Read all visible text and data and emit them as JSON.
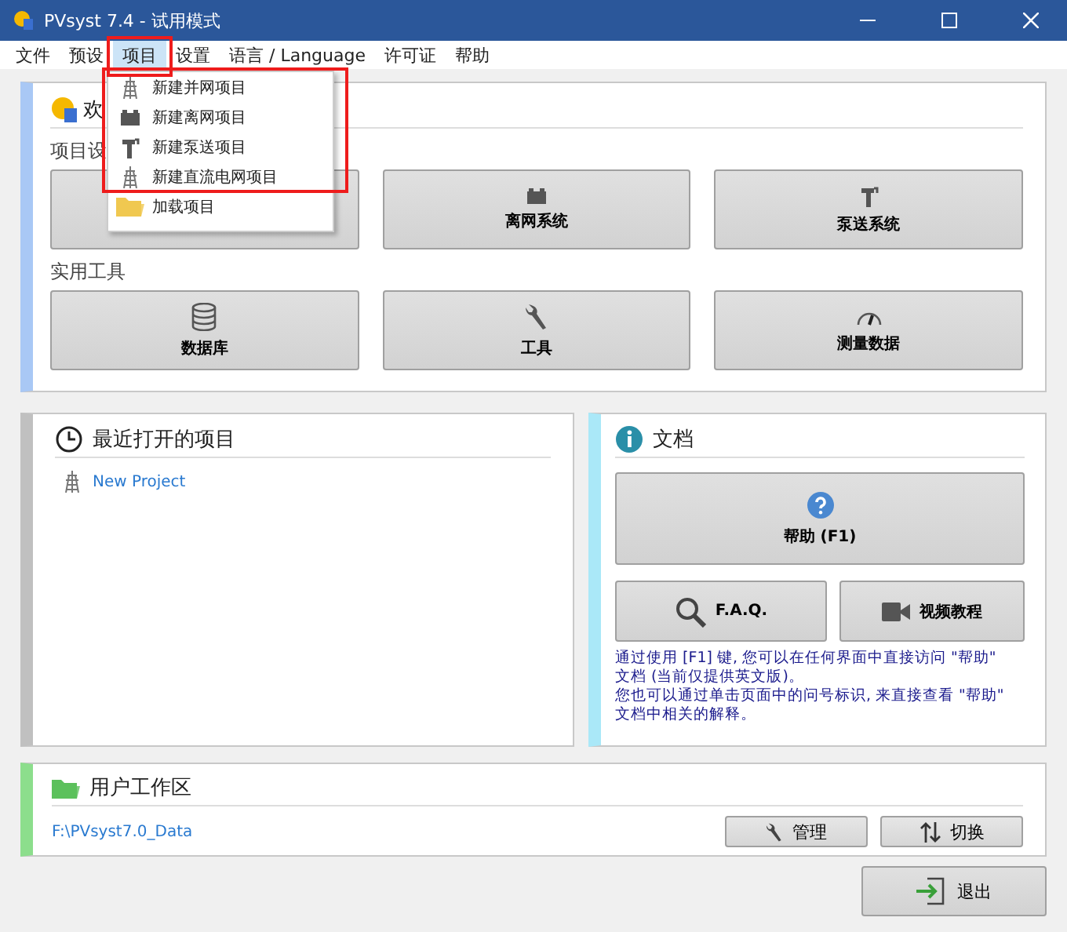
{
  "window": {
    "title": "PVsyst 7.4 - 试用模式"
  },
  "menu_bar": [
    {
      "label": "文件",
      "selected": false
    },
    {
      "label": "预设",
      "selected": false
    },
    {
      "label": "项目",
      "selected": true
    },
    {
      "label": "设置",
      "selected": false
    },
    {
      "label": "语言 / Language",
      "selected": false
    },
    {
      "label": "许可证",
      "selected": false
    },
    {
      "label": "帮助",
      "selected": false
    }
  ],
  "project_menu": {
    "items": [
      {
        "label": "新建并网项目"
      },
      {
        "label": "新建离网项目"
      },
      {
        "label": "新建泵送项目"
      },
      {
        "label": "新建直流电网项目"
      },
      {
        "label": "加载项目"
      }
    ]
  },
  "welcome": {
    "title": "欢",
    "project_design": {
      "heading": "项目设",
      "buttons": [
        {
          "kind": "blank"
        },
        {
          "kind": "labeled",
          "label": "离网系统"
        },
        {
          "kind": "labeled",
          "label": "泵送系统"
        }
      ]
    },
    "tools": {
      "heading": "实用工具",
      "buttons": [
        {
          "label": "数据库"
        },
        {
          "label": "工具"
        },
        {
          "label": "测量数据"
        }
      ]
    }
  },
  "recent": {
    "title": "最近打开的项目",
    "items": [
      {
        "label": "New Project"
      }
    ]
  },
  "docs": {
    "title": "文档",
    "help_button": "帮助 (F1)",
    "faq_button": "F.A.Q.",
    "video_button": "视频教程",
    "notes": [
      "通过使用 [F1] 键, 您可以在任何界面中直接访问 \"帮助\" 文档 (当前仅提供英文版)。",
      "您也可以通过单击页面中的问号标识, 来直接查看 \"帮助\" 文档中相关的解释。"
    ]
  },
  "workspace": {
    "title": "用户工作区",
    "path": "F:\\PVsyst7.0_Data",
    "buttons": [
      {
        "label": "管理"
      },
      {
        "label": "切换"
      }
    ]
  },
  "exit_button": "退出"
}
